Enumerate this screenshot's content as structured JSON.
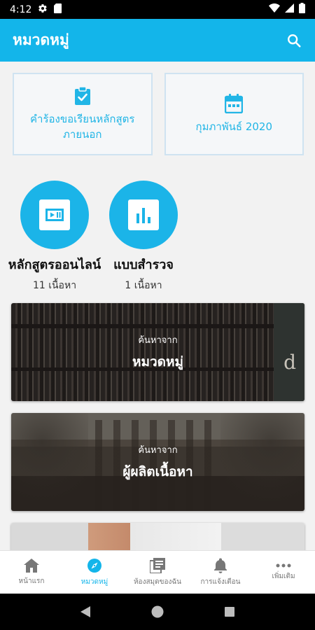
{
  "status_bar": {
    "time": "4:12"
  },
  "app_bar": {
    "title": "หมวดหมู่"
  },
  "cards": [
    {
      "line1": "คำร้องขอเรียนหลักสูตร",
      "line2": "ภายนอก",
      "icon": "clipboard-check-icon"
    },
    {
      "line1": "กุมภาพันธ์ 2020",
      "icon": "calendar-icon"
    }
  ],
  "categories": [
    {
      "name": "หลักสูตรออนไลน์",
      "count": "11 เนื้อหา",
      "icon": "video-player-icon"
    },
    {
      "name": "แบบสำรวจ",
      "count": "1 เนื้อหา",
      "icon": "bar-chart-icon"
    }
  ],
  "banners": [
    {
      "small": "ค้นหาจาก",
      "big": "หมวดหมู่"
    },
    {
      "small": "ค้นหาจาก",
      "big": "ผู้ผลิตเนื้อหา"
    }
  ],
  "bottom_nav": [
    {
      "label": "หน้าแรก",
      "icon": "home-icon",
      "active": false
    },
    {
      "label": "หมวดหมู่",
      "icon": "compass-icon",
      "active": true
    },
    {
      "label": "ห้องสมุดของฉัน",
      "icon": "library-icon",
      "active": false
    },
    {
      "label": "การแจ้งเตือน",
      "icon": "bell-icon",
      "active": false
    },
    {
      "label": "เพิ่มเติม",
      "icon": "more-icon",
      "active": false
    }
  ],
  "colors": {
    "accent": "#13b5ea",
    "circle": "#1bb4e8",
    "card_border": "#cfe3f1"
  }
}
